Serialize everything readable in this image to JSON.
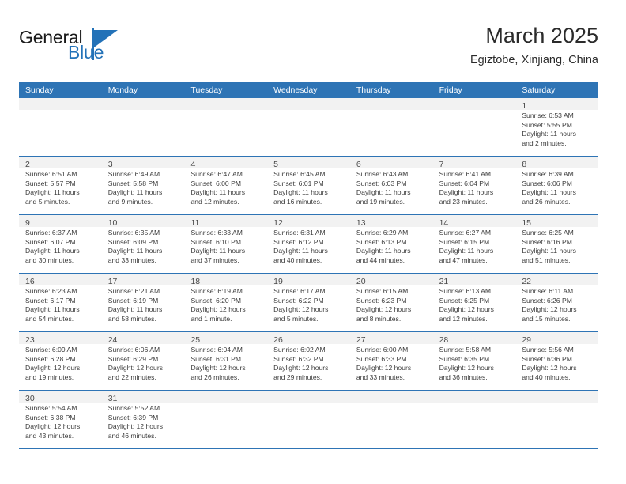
{
  "brand": {
    "line1": "General",
    "line2": "Blue",
    "flag_icon": "blue-triangle-flag",
    "accent_color": "#2372b8"
  },
  "header": {
    "title": "March 2025",
    "subtitle": "Egiztobe, Xinjiang, China"
  },
  "theme": {
    "header_row_color": "#2e74b5",
    "day_strip_color": "#f2f2f2",
    "grid_line_color": "#2e74b5",
    "text_color": "#3c3c3c"
  },
  "calendar": {
    "weekdays": [
      "Sunday",
      "Monday",
      "Tuesday",
      "Wednesday",
      "Thursday",
      "Friday",
      "Saturday"
    ],
    "weeks": [
      [
        {
          "day": "",
          "lines": []
        },
        {
          "day": "",
          "lines": []
        },
        {
          "day": "",
          "lines": []
        },
        {
          "day": "",
          "lines": []
        },
        {
          "day": "",
          "lines": []
        },
        {
          "day": "",
          "lines": []
        },
        {
          "day": "1",
          "lines": [
            "Sunrise: 6:53 AM",
            "Sunset: 5:55 PM",
            "Daylight: 11 hours",
            "and 2 minutes."
          ]
        }
      ],
      [
        {
          "day": "2",
          "lines": [
            "Sunrise: 6:51 AM",
            "Sunset: 5:57 PM",
            "Daylight: 11 hours",
            "and 5 minutes."
          ]
        },
        {
          "day": "3",
          "lines": [
            "Sunrise: 6:49 AM",
            "Sunset: 5:58 PM",
            "Daylight: 11 hours",
            "and 9 minutes."
          ]
        },
        {
          "day": "4",
          "lines": [
            "Sunrise: 6:47 AM",
            "Sunset: 6:00 PM",
            "Daylight: 11 hours",
            "and 12 minutes."
          ]
        },
        {
          "day": "5",
          "lines": [
            "Sunrise: 6:45 AM",
            "Sunset: 6:01 PM",
            "Daylight: 11 hours",
            "and 16 minutes."
          ]
        },
        {
          "day": "6",
          "lines": [
            "Sunrise: 6:43 AM",
            "Sunset: 6:03 PM",
            "Daylight: 11 hours",
            "and 19 minutes."
          ]
        },
        {
          "day": "7",
          "lines": [
            "Sunrise: 6:41 AM",
            "Sunset: 6:04 PM",
            "Daylight: 11 hours",
            "and 23 minutes."
          ]
        },
        {
          "day": "8",
          "lines": [
            "Sunrise: 6:39 AM",
            "Sunset: 6:06 PM",
            "Daylight: 11 hours",
            "and 26 minutes."
          ]
        }
      ],
      [
        {
          "day": "9",
          "lines": [
            "Sunrise: 6:37 AM",
            "Sunset: 6:07 PM",
            "Daylight: 11 hours",
            "and 30 minutes."
          ]
        },
        {
          "day": "10",
          "lines": [
            "Sunrise: 6:35 AM",
            "Sunset: 6:09 PM",
            "Daylight: 11 hours",
            "and 33 minutes."
          ]
        },
        {
          "day": "11",
          "lines": [
            "Sunrise: 6:33 AM",
            "Sunset: 6:10 PM",
            "Daylight: 11 hours",
            "and 37 minutes."
          ]
        },
        {
          "day": "12",
          "lines": [
            "Sunrise: 6:31 AM",
            "Sunset: 6:12 PM",
            "Daylight: 11 hours",
            "and 40 minutes."
          ]
        },
        {
          "day": "13",
          "lines": [
            "Sunrise: 6:29 AM",
            "Sunset: 6:13 PM",
            "Daylight: 11 hours",
            "and 44 minutes."
          ]
        },
        {
          "day": "14",
          "lines": [
            "Sunrise: 6:27 AM",
            "Sunset: 6:15 PM",
            "Daylight: 11 hours",
            "and 47 minutes."
          ]
        },
        {
          "day": "15",
          "lines": [
            "Sunrise: 6:25 AM",
            "Sunset: 6:16 PM",
            "Daylight: 11 hours",
            "and 51 minutes."
          ]
        }
      ],
      [
        {
          "day": "16",
          "lines": [
            "Sunrise: 6:23 AM",
            "Sunset: 6:17 PM",
            "Daylight: 11 hours",
            "and 54 minutes."
          ]
        },
        {
          "day": "17",
          "lines": [
            "Sunrise: 6:21 AM",
            "Sunset: 6:19 PM",
            "Daylight: 11 hours",
            "and 58 minutes."
          ]
        },
        {
          "day": "18",
          "lines": [
            "Sunrise: 6:19 AM",
            "Sunset: 6:20 PM",
            "Daylight: 12 hours",
            "and 1 minute."
          ]
        },
        {
          "day": "19",
          "lines": [
            "Sunrise: 6:17 AM",
            "Sunset: 6:22 PM",
            "Daylight: 12 hours",
            "and 5 minutes."
          ]
        },
        {
          "day": "20",
          "lines": [
            "Sunrise: 6:15 AM",
            "Sunset: 6:23 PM",
            "Daylight: 12 hours",
            "and 8 minutes."
          ]
        },
        {
          "day": "21",
          "lines": [
            "Sunrise: 6:13 AM",
            "Sunset: 6:25 PM",
            "Daylight: 12 hours",
            "and 12 minutes."
          ]
        },
        {
          "day": "22",
          "lines": [
            "Sunrise: 6:11 AM",
            "Sunset: 6:26 PM",
            "Daylight: 12 hours",
            "and 15 minutes."
          ]
        }
      ],
      [
        {
          "day": "23",
          "lines": [
            "Sunrise: 6:09 AM",
            "Sunset: 6:28 PM",
            "Daylight: 12 hours",
            "and 19 minutes."
          ]
        },
        {
          "day": "24",
          "lines": [
            "Sunrise: 6:06 AM",
            "Sunset: 6:29 PM",
            "Daylight: 12 hours",
            "and 22 minutes."
          ]
        },
        {
          "day": "25",
          "lines": [
            "Sunrise: 6:04 AM",
            "Sunset: 6:31 PM",
            "Daylight: 12 hours",
            "and 26 minutes."
          ]
        },
        {
          "day": "26",
          "lines": [
            "Sunrise: 6:02 AM",
            "Sunset: 6:32 PM",
            "Daylight: 12 hours",
            "and 29 minutes."
          ]
        },
        {
          "day": "27",
          "lines": [
            "Sunrise: 6:00 AM",
            "Sunset: 6:33 PM",
            "Daylight: 12 hours",
            "and 33 minutes."
          ]
        },
        {
          "day": "28",
          "lines": [
            "Sunrise: 5:58 AM",
            "Sunset: 6:35 PM",
            "Daylight: 12 hours",
            "and 36 minutes."
          ]
        },
        {
          "day": "29",
          "lines": [
            "Sunrise: 5:56 AM",
            "Sunset: 6:36 PM",
            "Daylight: 12 hours",
            "and 40 minutes."
          ]
        }
      ],
      [
        {
          "day": "30",
          "lines": [
            "Sunrise: 5:54 AM",
            "Sunset: 6:38 PM",
            "Daylight: 12 hours",
            "and 43 minutes."
          ]
        },
        {
          "day": "31",
          "lines": [
            "Sunrise: 5:52 AM",
            "Sunset: 6:39 PM",
            "Daylight: 12 hours",
            "and 46 minutes."
          ]
        },
        {
          "day": "",
          "lines": []
        },
        {
          "day": "",
          "lines": []
        },
        {
          "day": "",
          "lines": []
        },
        {
          "day": "",
          "lines": []
        },
        {
          "day": "",
          "lines": []
        }
      ]
    ]
  }
}
